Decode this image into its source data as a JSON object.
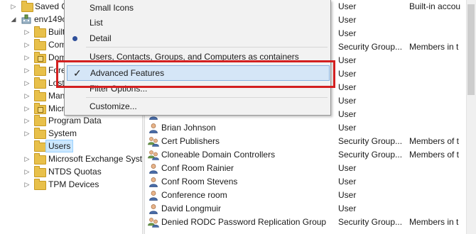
{
  "tree": {
    "items": [
      {
        "label": "Saved Q",
        "kind": "folder",
        "expander": "collapsed"
      },
      {
        "label": "env149c",
        "kind": "domain",
        "expander": "expanded"
      },
      {
        "label": "Built",
        "kind": "folder",
        "expander": "collapsed"
      },
      {
        "label": "Com",
        "kind": "folder",
        "expander": "collapsed"
      },
      {
        "label": "Dom",
        "kind": "folder-grid",
        "expander": "collapsed"
      },
      {
        "label": "Fore",
        "kind": "folder",
        "expander": "collapsed"
      },
      {
        "label": "Lost",
        "kind": "folder",
        "expander": "collapsed"
      },
      {
        "label": "Man",
        "kind": "folder",
        "expander": "collapsed"
      },
      {
        "label": "Micr",
        "kind": "folder-grid",
        "expander": "collapsed"
      },
      {
        "label": "Program Data",
        "kind": "folder",
        "expander": "collapsed"
      },
      {
        "label": "System",
        "kind": "folder",
        "expander": "collapsed"
      },
      {
        "label": "Users",
        "kind": "folder",
        "expander": "none",
        "selected": true
      },
      {
        "label": "Microsoft Exchange Syste",
        "kind": "folder",
        "expander": "collapsed"
      },
      {
        "label": "NTDS Quotas",
        "kind": "folder",
        "expander": "collapsed"
      },
      {
        "label": "TPM Devices",
        "kind": "folder",
        "expander": "collapsed"
      }
    ]
  },
  "list": {
    "rows": [
      {
        "name": "",
        "type": "User",
        "desc": "Built-in accou",
        "icon": "user-icon"
      },
      {
        "name": "",
        "type": "User",
        "desc": "",
        "icon": "user-icon"
      },
      {
        "name": "",
        "type": "User",
        "desc": "",
        "icon": "user-icon"
      },
      {
        "name": "",
        "type": "Security Group...",
        "desc": "Members in t",
        "icon": "group-icon"
      },
      {
        "name": "",
        "type": "User",
        "desc": "",
        "icon": "user-icon"
      },
      {
        "name": "",
        "type": "User",
        "desc": "",
        "icon": "user-icon"
      },
      {
        "name": "",
        "type": "User",
        "desc": "",
        "icon": "user-icon"
      },
      {
        "name": "",
        "type": "User",
        "desc": "",
        "icon": "user-icon"
      },
      {
        "name": "",
        "type": "User",
        "desc": "",
        "icon": "user-icon"
      },
      {
        "name": "Brian Johnson",
        "type": "User",
        "desc": "",
        "icon": "user-icon"
      },
      {
        "name": "Cert Publishers",
        "type": "Security Group...",
        "desc": "Members of t",
        "icon": "group-icon"
      },
      {
        "name": "Cloneable Domain Controllers",
        "type": "Security Group...",
        "desc": "Members of t",
        "icon": "group-icon"
      },
      {
        "name": "Conf Room Rainier",
        "type": "User",
        "desc": "",
        "icon": "user-icon"
      },
      {
        "name": "Conf Room Stevens",
        "type": "User",
        "desc": "",
        "icon": "user-icon"
      },
      {
        "name": "Conference room",
        "type": "User",
        "desc": "",
        "icon": "user-icon"
      },
      {
        "name": "David Longmuir",
        "type": "User",
        "desc": "",
        "icon": "user-icon"
      },
      {
        "name": "Denied RODC Password Replication Group",
        "type": "Security Group...",
        "desc": "Members in t",
        "icon": "group-icon"
      }
    ]
  },
  "menu": {
    "items": [
      {
        "label": "Small Icons",
        "state": "none"
      },
      {
        "label": "List",
        "state": "none"
      },
      {
        "label": "Detail",
        "state": "radio"
      },
      {
        "label": "Users, Contacts, Groups, and Computers as containers",
        "state": "none"
      },
      {
        "label": "Advanced Features",
        "state": "check",
        "highlighted": true
      },
      {
        "label": "Filter Options...",
        "state": "none"
      },
      {
        "label": "Customize...",
        "state": "none"
      }
    ]
  },
  "colors": {
    "highlight_border": "#d32020",
    "menu_highlight": "#d5e6f7",
    "selected_node": "#cce8ff"
  }
}
